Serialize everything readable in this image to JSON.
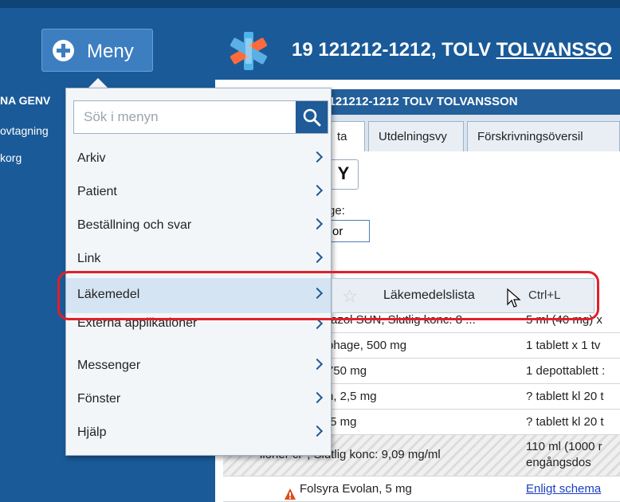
{
  "header": {
    "menu_button_label": "Meny",
    "patient_id": "19 121212-1212,",
    "patient_given": "TOLV",
    "patient_surname": "TOLVANSSO"
  },
  "left_panel": {
    "lines": [
      "NA GENV",
      "ovtagning",
      "korg"
    ]
  },
  "content": {
    "header_text": "9 121212-1212 TOLV TOLVANSSON",
    "tabs": [
      "ta",
      "Utdelningsvy",
      "Förskrivningsöversil"
    ],
    "filter_label": "ge:",
    "filter_value": "or",
    "rows": [
      {
        "name": "razol SUN, Slutlig konc: 8 ...",
        "dose": "5 ml (40 mg) x"
      },
      {
        "name": "phage, 500 mg",
        "dose": "1 tablett x 1 tv"
      },
      {
        "name": "750 mg",
        "dose": "1 depottablett :"
      },
      {
        "name": "n, 2,5 mg",
        "dose": "? tablett kl 20 t"
      },
      {
        "name": ",5 mg",
        "dose": "? tablett kl 20 t"
      },
      {
        "name": "iioner cr*, Slutlig konc: 9,09 mg/ml",
        "dose": "110 ml (1000 r",
        "dose2": "engångsdos"
      },
      {
        "name": "Folsyra Evolan, 5 mg",
        "dose": "Enligt schema"
      }
    ]
  },
  "menu": {
    "search_placeholder": "Sök i menyn",
    "items": [
      {
        "label": "Arkiv"
      },
      {
        "label": "Patient"
      },
      {
        "label": "Beställning och svar"
      },
      {
        "label": "Link"
      },
      {
        "label": "Läkemedel"
      },
      {
        "label": "Externa applikationer"
      },
      {
        "label": "Messenger"
      },
      {
        "label": "Fönster"
      },
      {
        "label": "Hjälp"
      }
    ]
  },
  "submenu": {
    "label": "Läkemedelslista",
    "shortcut": "Ctrl+L"
  },
  "colors": {
    "topbar": "#1a5a98",
    "accent": "#1e5b97",
    "highlight_ring": "#e0202a",
    "menu_hover": "#d5e4f2"
  }
}
